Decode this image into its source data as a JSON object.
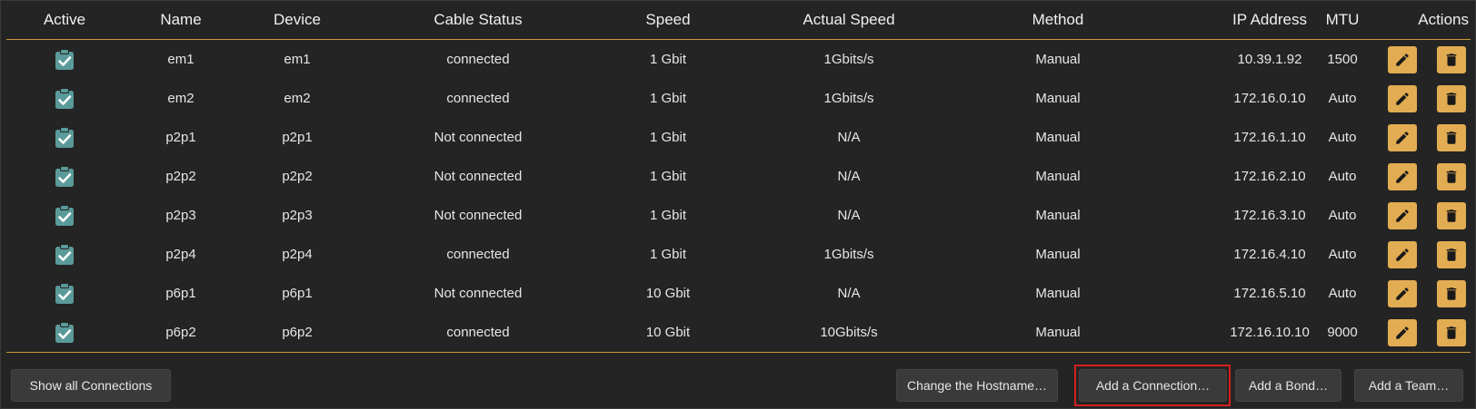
{
  "table": {
    "headers": {
      "active": "Active",
      "name": "Name",
      "device": "Device",
      "cable_status": "Cable Status",
      "speed": "Speed",
      "actual_speed": "Actual Speed",
      "method": "Method",
      "ip_address": "IP Address",
      "mtu": "MTU",
      "actions": "Actions"
    },
    "rows": [
      {
        "active": true,
        "name": "em1",
        "device": "em1",
        "cable_status": "connected",
        "speed": "1 Gbit",
        "actual_speed": "1Gbits/s",
        "method": "Manual",
        "ip_address": "10.39.1.92",
        "mtu": "1500"
      },
      {
        "active": true,
        "name": "em2",
        "device": "em2",
        "cable_status": "connected",
        "speed": "1 Gbit",
        "actual_speed": "1Gbits/s",
        "method": "Manual",
        "ip_address": "172.16.0.10",
        "mtu": "Auto"
      },
      {
        "active": true,
        "name": "p2p1",
        "device": "p2p1",
        "cable_status": "Not connected",
        "speed": "1 Gbit",
        "actual_speed": "N/A",
        "method": "Manual",
        "ip_address": "172.16.1.10",
        "mtu": "Auto"
      },
      {
        "active": true,
        "name": "p2p2",
        "device": "p2p2",
        "cable_status": "Not connected",
        "speed": "1 Gbit",
        "actual_speed": "N/A",
        "method": "Manual",
        "ip_address": "172.16.2.10",
        "mtu": "Auto"
      },
      {
        "active": true,
        "name": "p2p3",
        "device": "p2p3",
        "cable_status": "Not connected",
        "speed": "1 Gbit",
        "actual_speed": "N/A",
        "method": "Manual",
        "ip_address": "172.16.3.10",
        "mtu": "Auto"
      },
      {
        "active": true,
        "name": "p2p4",
        "device": "p2p4",
        "cable_status": "connected",
        "speed": "1 Gbit",
        "actual_speed": "1Gbits/s",
        "method": "Manual",
        "ip_address": "172.16.4.10",
        "mtu": "Auto"
      },
      {
        "active": true,
        "name": "p6p1",
        "device": "p6p1",
        "cable_status": "Not connected",
        "speed": "10 Gbit",
        "actual_speed": "N/A",
        "method": "Manual",
        "ip_address": "172.16.5.10",
        "mtu": "Auto"
      },
      {
        "active": true,
        "name": "p6p2",
        "device": "p6p2",
        "cable_status": "connected",
        "speed": "10 Gbit",
        "actual_speed": "10Gbits/s",
        "method": "Manual",
        "ip_address": "172.16.10.10",
        "mtu": "9000"
      }
    ]
  },
  "footer": {
    "show_all": "Show all Connections",
    "change_hostname": "Change the Hostname…",
    "add_connection": "Add a Connection…",
    "add_bond": "Add a Bond…",
    "add_team": "Add a Team…"
  },
  "icons": {
    "active": "clipboard-check-icon",
    "edit": "pencil-icon",
    "delete": "trash-icon"
  },
  "colors": {
    "accent": "#e2ad52",
    "active_icon": "#5a9a9a",
    "highlight": "#d41f1f"
  }
}
